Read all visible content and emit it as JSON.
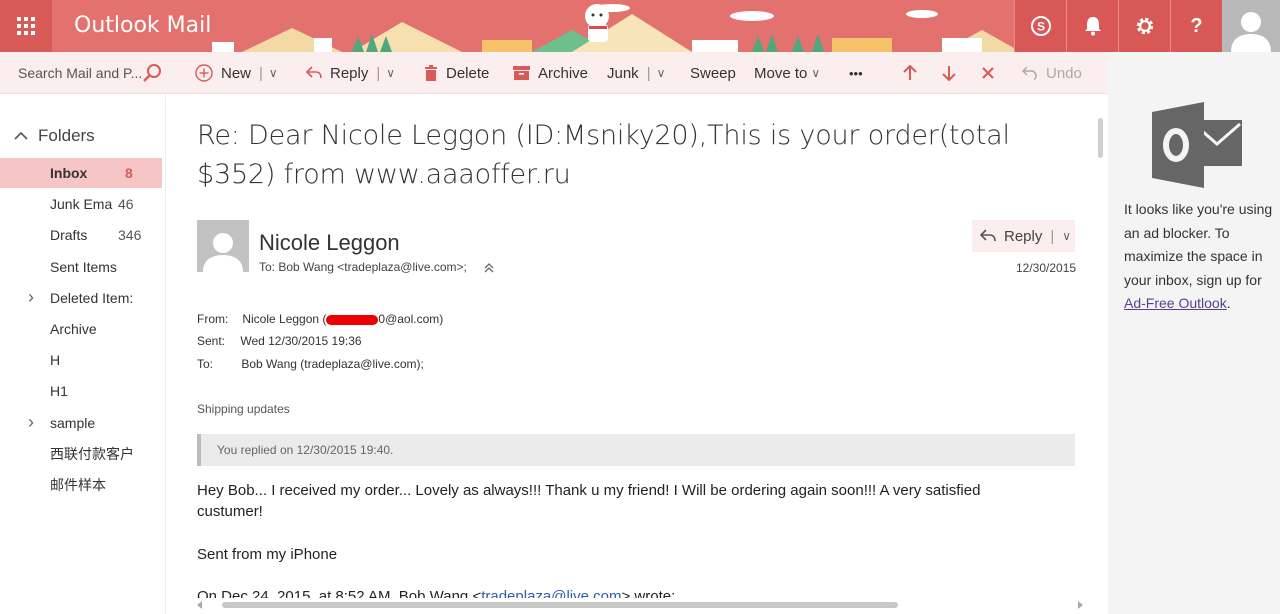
{
  "app": {
    "title": "Outlook Mail"
  },
  "topbar": {
    "icons": [
      "waffle-icon",
      "skype-icon",
      "bell-icon",
      "gear-icon",
      "help-icon",
      "avatar"
    ],
    "help_label": "?",
    "accent": "#e3716e"
  },
  "search": {
    "placeholder": "Search Mail and P..."
  },
  "toolbar": {
    "new_label": "New",
    "reply_label": "Reply",
    "delete_label": "Delete",
    "archive_label": "Archive",
    "junk_label": "Junk",
    "sweep_label": "Sweep",
    "moveto_label": "Move to",
    "more_label": "•••",
    "undo_label": "Undo",
    "sep": "|",
    "caret": "∨"
  },
  "sidebar": {
    "folders_label": "Folders",
    "items": [
      {
        "label": "Inbox",
        "count": "8",
        "active": true,
        "expandable": false
      },
      {
        "label": "Junk Ema",
        "count": "46",
        "active": false,
        "expandable": false
      },
      {
        "label": "Drafts",
        "count": "346",
        "active": false,
        "expandable": false
      },
      {
        "label": "Sent Items",
        "count": "",
        "active": false,
        "expandable": false
      },
      {
        "label": "Deleted Item:",
        "count": "",
        "active": false,
        "expandable": true
      },
      {
        "label": "Archive",
        "count": "",
        "active": false,
        "expandable": false
      },
      {
        "label": "H",
        "count": "",
        "active": false,
        "expandable": false
      },
      {
        "label": "H1",
        "count": "",
        "active": false,
        "expandable": false
      },
      {
        "label": "sample",
        "count": "",
        "active": false,
        "expandable": true
      },
      {
        "label": "西联付款客户",
        "count": "",
        "active": false,
        "expandable": false
      },
      {
        "label": "邮件样本",
        "count": "",
        "active": false,
        "expandable": false
      }
    ]
  },
  "message": {
    "subject": "Re: Dear Nicole Leggon (ID:Msniky20),This is your order(total $352) from www.aaaoffer.ru",
    "sender_name": "Nicole Leggon",
    "to_line": "To: Bob Wang <tradeplaza@live.com>;",
    "reply_label": "Reply",
    "date": "12/30/2015",
    "header": {
      "from_key": "From:",
      "from_value_pre": "Nicole Leggon (",
      "from_value_post": "0@aol.com)",
      "sent_key": "Sent:",
      "sent_value": "Wed 12/30/2015 19:36",
      "to_key": "To:",
      "to_value": "Bob Wang (tradeplaza@live.com);"
    },
    "shipping": "Shipping updates",
    "replied_notice": "You replied on 12/30/2015 19:40.",
    "body_line1": "Hey Bob... I received my order... Lovely as always!!! Thank u my friend! I Will be ordering again soon!!! A very satisfied custumer!",
    "body_line2": "Sent from my iPhone",
    "body_line3_pre": "On Dec 24, 2015, at 8:52 AM, Bob Wang <",
    "body_line3_link": "tradeplaza@live.com",
    "body_line3_post": "> wrote:"
  },
  "ad": {
    "text": "It looks like you're using an ad blocker. To maximize the space in your inbox, sign up for ",
    "link": "Ad-Free Outlook",
    "suffix": "."
  }
}
